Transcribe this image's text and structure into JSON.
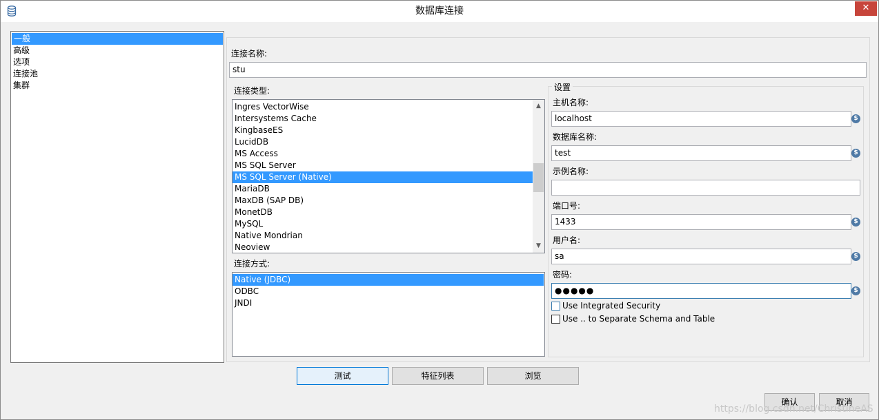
{
  "window": {
    "title": "数据库连接",
    "close_glyph": "✕"
  },
  "nav": {
    "items": [
      {
        "label": "一般",
        "selected": true
      },
      {
        "label": "高级",
        "selected": false
      },
      {
        "label": "选项",
        "selected": false
      },
      {
        "label": "连接池",
        "selected": false
      },
      {
        "label": "集群",
        "selected": false
      }
    ]
  },
  "general": {
    "connection_name_label": "连接名称:",
    "connection_name_value": "stu",
    "connection_type_label": "连接类型:",
    "connection_types": [
      "Ingres VectorWise",
      "Intersystems Cache",
      "KingbaseES",
      "LucidDB",
      "MS Access",
      "MS SQL Server",
      "MS SQL Server (Native)",
      "MariaDB",
      "MaxDB (SAP DB)",
      "MonetDB",
      "MySQL",
      "Native Mondrian",
      "Neoview"
    ],
    "connection_type_selected": "MS SQL Server (Native)",
    "access_label": "连接方式:",
    "access_methods": [
      "Native (JDBC)",
      "ODBC",
      "JNDI"
    ],
    "access_selected": "Native (JDBC)"
  },
  "settings": {
    "group_title": "设置",
    "host_label": "主机名称:",
    "host_value": "localhost",
    "db_label": "数据库名称:",
    "db_value": "test",
    "instance_label": "示例名称:",
    "instance_value": "",
    "port_label": "端口号:",
    "port_value": "1433",
    "user_label": "用户名:",
    "user_value": "sa",
    "password_label": "密码:",
    "password_value": "●●●●●",
    "integrated_security_label": "Use Integrated Security",
    "integrated_security_checked": false,
    "separate_schema_label": "Use .. to Separate Schema and Table",
    "separate_schema_checked": false,
    "var_icon_glyph": "$"
  },
  "buttons": {
    "test": "测试",
    "features": "特征列表",
    "explore": "浏览",
    "ok": "确认",
    "cancel": "取消"
  },
  "watermark": "https://blog.csdn.net/ChristineAS"
}
